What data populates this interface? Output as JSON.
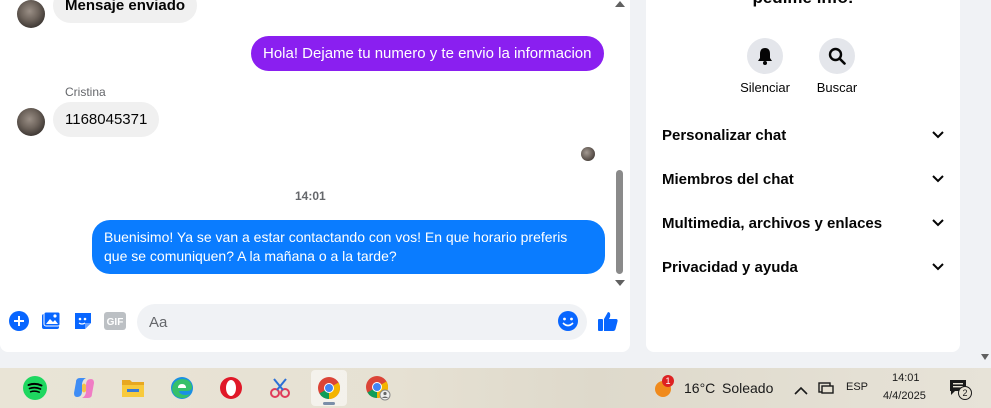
{
  "chat": {
    "messages": [
      {
        "type": "incoming",
        "text": "Mensaje enviado"
      },
      {
        "type": "outgoing",
        "text": "Hola! Dejame tu numero y te envio la informacion"
      },
      {
        "type": "incoming",
        "sender": "Cristina",
        "text": "1168045371"
      },
      {
        "type": "timestamp",
        "text": "14:01"
      },
      {
        "type": "outgoing",
        "text_line1": "Buenisimo! Ya se van a estar contactando con vos! En que horario preferis",
        "text_line2": "que se comuniquen? A la mañana o a la tarde?"
      }
    ],
    "composer": {
      "placeholder": "Aa"
    },
    "colors": {
      "outgoing": "#0a7cff",
      "outgoing_alt": "#8a1ff0",
      "incoming": "#f0f0f0"
    },
    "icons": [
      "plus-circle-icon",
      "image-icon",
      "sticker-icon",
      "gif-icon",
      "emoji-icon",
      "thumbs-up-icon"
    ]
  },
  "info_panel": {
    "title": "pedime info!",
    "actions": [
      {
        "label": "Silenciar",
        "icon": "bell-icon"
      },
      {
        "label": "Buscar",
        "icon": "search-icon"
      }
    ],
    "sections": [
      {
        "label": "Personalizar chat"
      },
      {
        "label": "Miembros del chat"
      },
      {
        "label": "Multimedia, archivos y enlaces"
      },
      {
        "label": "Privacidad y ayuda"
      }
    ]
  },
  "taskbar": {
    "apps": [
      "spotify-icon",
      "copilot-icon",
      "file-explorer-icon",
      "edge-icon",
      "opera-icon",
      "snipping-tool-icon",
      "chrome-icon",
      "chrome-profile-icon"
    ],
    "weather": {
      "badge": "1",
      "temp": "16°C",
      "condition": "Soleado"
    },
    "language": "ESP",
    "time": "14:01",
    "date": "4/4/2025",
    "notifications": "2"
  }
}
